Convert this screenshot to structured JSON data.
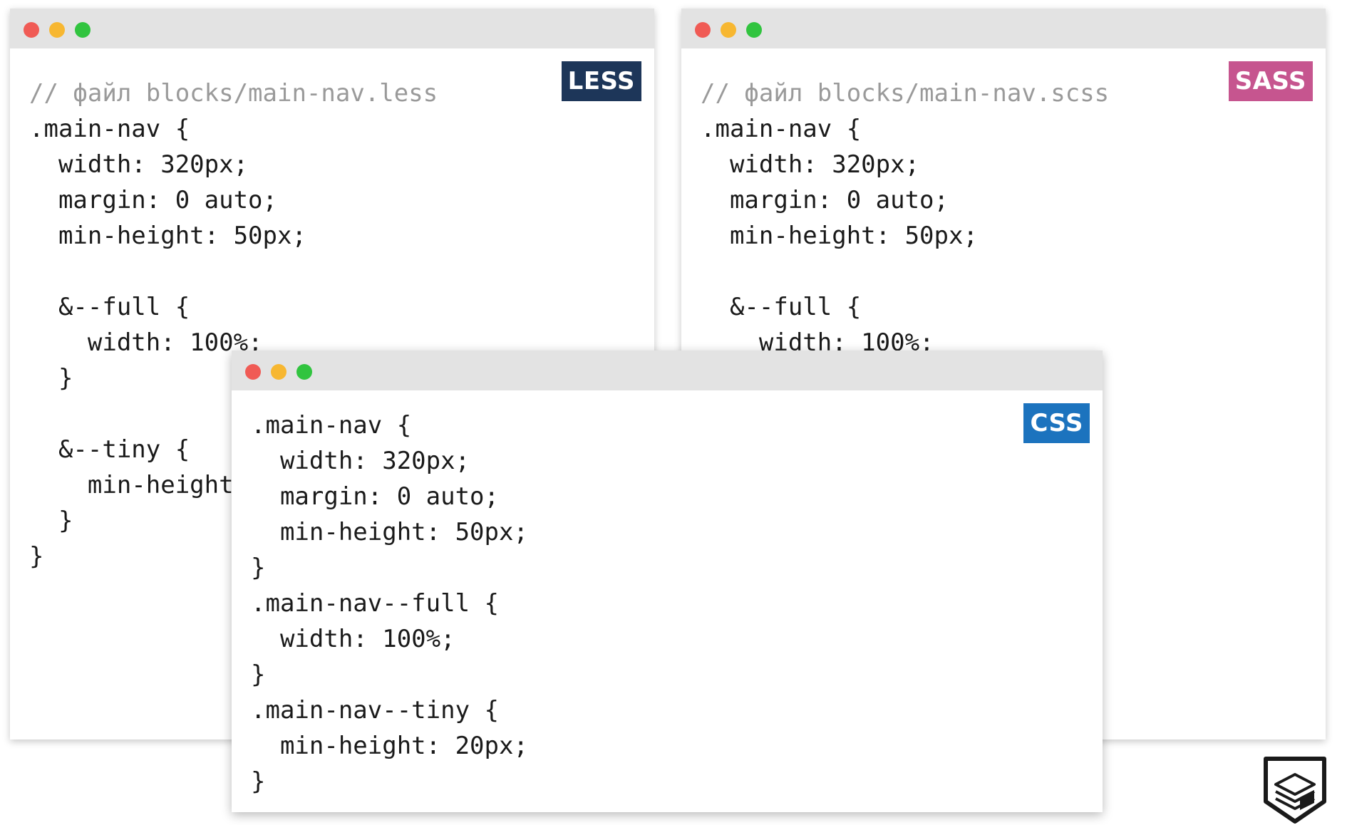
{
  "colors": {
    "titlebar": "#e3e3e3",
    "dot_red": "#f05b55",
    "dot_yellow": "#f7b731",
    "dot_green": "#31c43f",
    "less_badge": "#1d3659",
    "sass_badge": "#c6558f",
    "css_badge": "#1c73be",
    "comment": "#9a9a9a",
    "code": "#1a1a1a"
  },
  "less_window": {
    "badge": "LESS",
    "lines": [
      "// файл blocks/main-nav.less",
      ".main-nav {",
      "  width: 320px;",
      "  margin: 0 auto;",
      "  min-height: 50px;",
      "",
      "  &--full {",
      "    width: 100%;",
      "  }",
      "",
      "  &--tiny {",
      "    min-height",
      "  }",
      "}"
    ]
  },
  "sass_window": {
    "badge": "SASS",
    "lines": [
      "// файл blocks/main-nav.scss",
      ".main-nav {",
      "  width: 320px;",
      "  margin: 0 auto;",
      "  min-height: 50px;",
      "",
      "  &--full {",
      "    width: 100%;"
    ]
  },
  "css_window": {
    "badge": "CSS",
    "lines": [
      ".main-nav {",
      "  width: 320px;",
      "  margin: 0 auto;",
      "  min-height: 50px;",
      "}",
      ".main-nav--full {",
      "  width: 100%;",
      "}",
      ".main-nav--tiny {",
      "  min-height: 20px;",
      "}"
    ]
  },
  "logo": {
    "icon": "htmlacademy-logo-icon"
  }
}
